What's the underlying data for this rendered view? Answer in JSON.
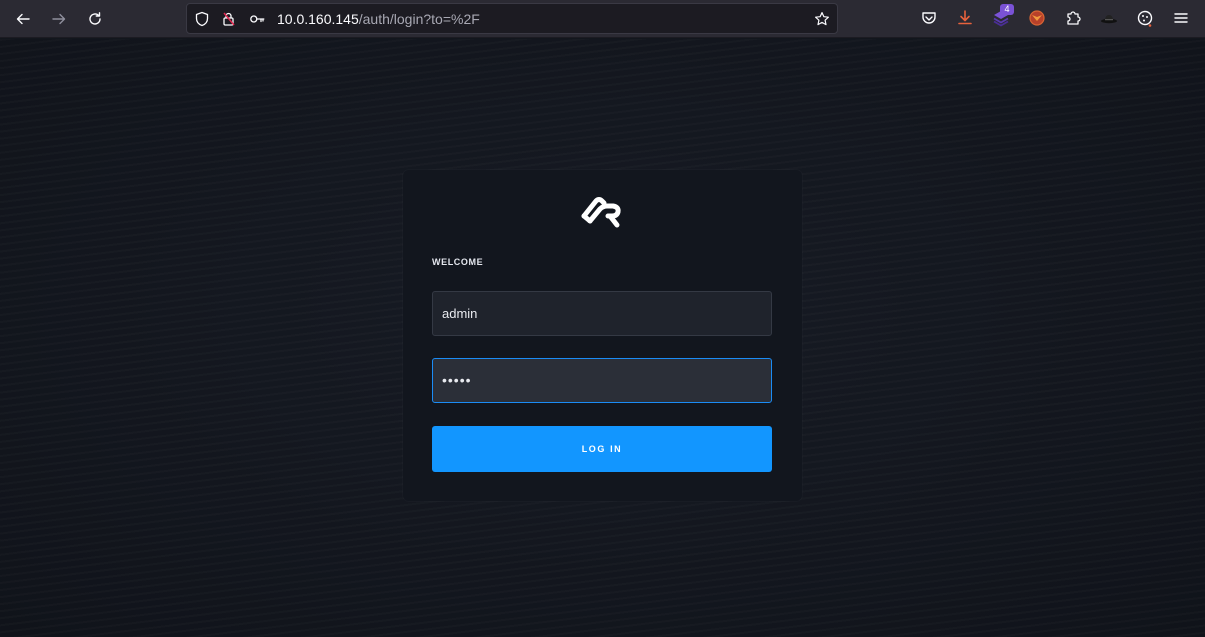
{
  "browser": {
    "url_host": "10.0.160.145",
    "url_path": "/auth/login?to=%2F",
    "extensions_badge": "4"
  },
  "icons": {
    "back": "arrow-left-icon",
    "forward": "arrow-right-icon",
    "reload": "reload-icon",
    "tracking": "shield-icon",
    "insecure": "lock-warning-icon",
    "permissions": "key-icon",
    "bookmark": "star-icon",
    "pocket": "pocket-icon",
    "downloads": "download-icon",
    "menu": "hamburger-menu-icon"
  },
  "login": {
    "heading": "WELCOME",
    "username_value": "admin",
    "password_mask": "•••••",
    "submit_label": "LOG IN"
  },
  "colors": {
    "accent": "#1296ff",
    "focus_border": "#1b8cf5",
    "background": "#141821",
    "card": "#12161e"
  }
}
